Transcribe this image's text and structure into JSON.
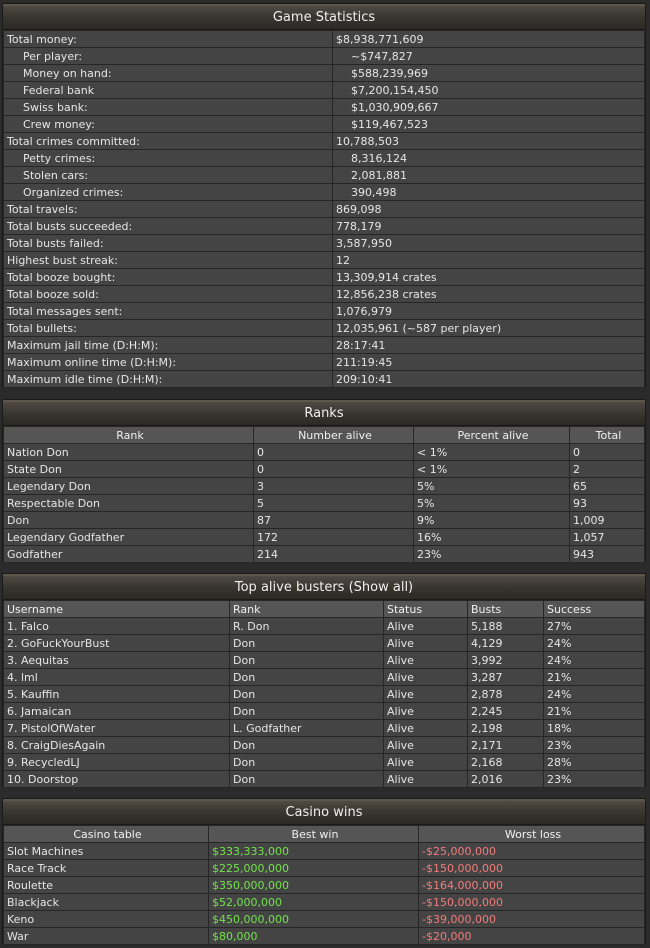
{
  "game_statistics": {
    "title": "Game Statistics",
    "rows": [
      {
        "label": "Total money:",
        "value": "$8,938,771,609",
        "indent": false
      },
      {
        "label": "Per player:",
        "value": "~$747,827",
        "indent": true
      },
      {
        "label": "Money on hand:",
        "value": "$588,239,969",
        "indent": true
      },
      {
        "label": "Federal bank",
        "value": "$7,200,154,450",
        "indent": true
      },
      {
        "label": "Swiss bank:",
        "value": "$1,030,909,667",
        "indent": true
      },
      {
        "label": "Crew money:",
        "value": "$119,467,523",
        "indent": true
      },
      {
        "label": "Total crimes committed:",
        "value": "10,788,503",
        "indent": false
      },
      {
        "label": "Petty crimes:",
        "value": "8,316,124",
        "indent": true
      },
      {
        "label": "Stolen cars:",
        "value": "2,081,881",
        "indent": true
      },
      {
        "label": "Organized crimes:",
        "value": "390,498",
        "indent": true
      },
      {
        "label": "Total travels:",
        "value": "869,098",
        "indent": false
      },
      {
        "label": "Total busts succeeded:",
        "value": "778,179",
        "indent": false
      },
      {
        "label": "Total busts failed:",
        "value": "3,587,950",
        "indent": false
      },
      {
        "label": "Highest bust streak:",
        "value": "12",
        "indent": false
      },
      {
        "label": "Total booze bought:",
        "value": "13,309,914 crates",
        "indent": false
      },
      {
        "label": "Total booze sold:",
        "value": "12,856,238 crates",
        "indent": false
      },
      {
        "label": "Total messages sent:",
        "value": "1,076,979",
        "indent": false
      },
      {
        "label": "Total bullets:",
        "value": "12,035,961 (~587 per player)",
        "indent": false
      },
      {
        "label": "Maximum jail time (D:H:M):",
        "value": "28:17:41",
        "indent": false
      },
      {
        "label": "Maximum online time (D:H:M):",
        "value": "211:19:45",
        "indent": false
      },
      {
        "label": "Maximum idle time (D:H:M):",
        "value": "209:10:41",
        "indent": false
      }
    ]
  },
  "ranks": {
    "title": "Ranks",
    "columns": [
      "Rank",
      "Number alive",
      "Percent alive",
      "Total"
    ],
    "rows": [
      [
        "Nation Don",
        "0",
        "< 1%",
        "0"
      ],
      [
        "State Don",
        "0",
        "< 1%",
        "2"
      ],
      [
        "Legendary Don",
        "3",
        "5%",
        "65"
      ],
      [
        "Respectable Don",
        "5",
        "5%",
        "93"
      ],
      [
        "Don",
        "87",
        "9%",
        "1,009"
      ],
      [
        "Legendary Godfather",
        "172",
        "16%",
        "1,057"
      ],
      [
        "Godfather",
        "214",
        "23%",
        "943"
      ]
    ]
  },
  "busters": {
    "title": "Top alive busters",
    "show_all": "(Show all)",
    "columns": [
      "Username",
      "Rank",
      "Status",
      "Busts",
      "Success"
    ],
    "rows": [
      [
        "1. Falco",
        "R. Don",
        "Alive",
        "5,188",
        "27%"
      ],
      [
        "2. GoFuckYourBust",
        "Don",
        "Alive",
        "4,129",
        "24%"
      ],
      [
        "3. Aequitas",
        "Don",
        "Alive",
        "3,992",
        "24%"
      ],
      [
        "4. lml",
        "Don",
        "Alive",
        "3,287",
        "21%"
      ],
      [
        "5. Kauffin",
        "Don",
        "Alive",
        "2,878",
        "24%"
      ],
      [
        "6. Jamaican",
        "Don",
        "Alive",
        "2,245",
        "21%"
      ],
      [
        "7. PistolOfWater",
        "L. Godfather",
        "Alive",
        "2,198",
        "18%"
      ],
      [
        "8. CraigDiesAgain",
        "Don",
        "Alive",
        "2,171",
        "23%"
      ],
      [
        "9. RecycledLJ",
        "Don",
        "Alive",
        "2,168",
        "28%"
      ],
      [
        "10. Doorstop",
        "Don",
        "Alive",
        "2,016",
        "23%"
      ]
    ]
  },
  "casino": {
    "title": "Casino wins",
    "columns": [
      "Casino table",
      "Best win",
      "Worst loss"
    ],
    "rows": [
      [
        "Slot Machines",
        "$333,333,000",
        "-$25,000,000"
      ],
      [
        "Race Track",
        "$225,000,000",
        "-$150,000,000"
      ],
      [
        "Roulette",
        "$350,000,000",
        "-$164,000,000"
      ],
      [
        "Blackjack",
        "$52,000,000",
        "-$150,000,000"
      ],
      [
        "Keno",
        "$450,000,000",
        "-$39,000,000"
      ],
      [
        "War",
        "$80,000",
        "-$20,000"
      ]
    ],
    "colors": {
      "win": "#72e24b",
      "loss": "#f27c7c"
    }
  }
}
